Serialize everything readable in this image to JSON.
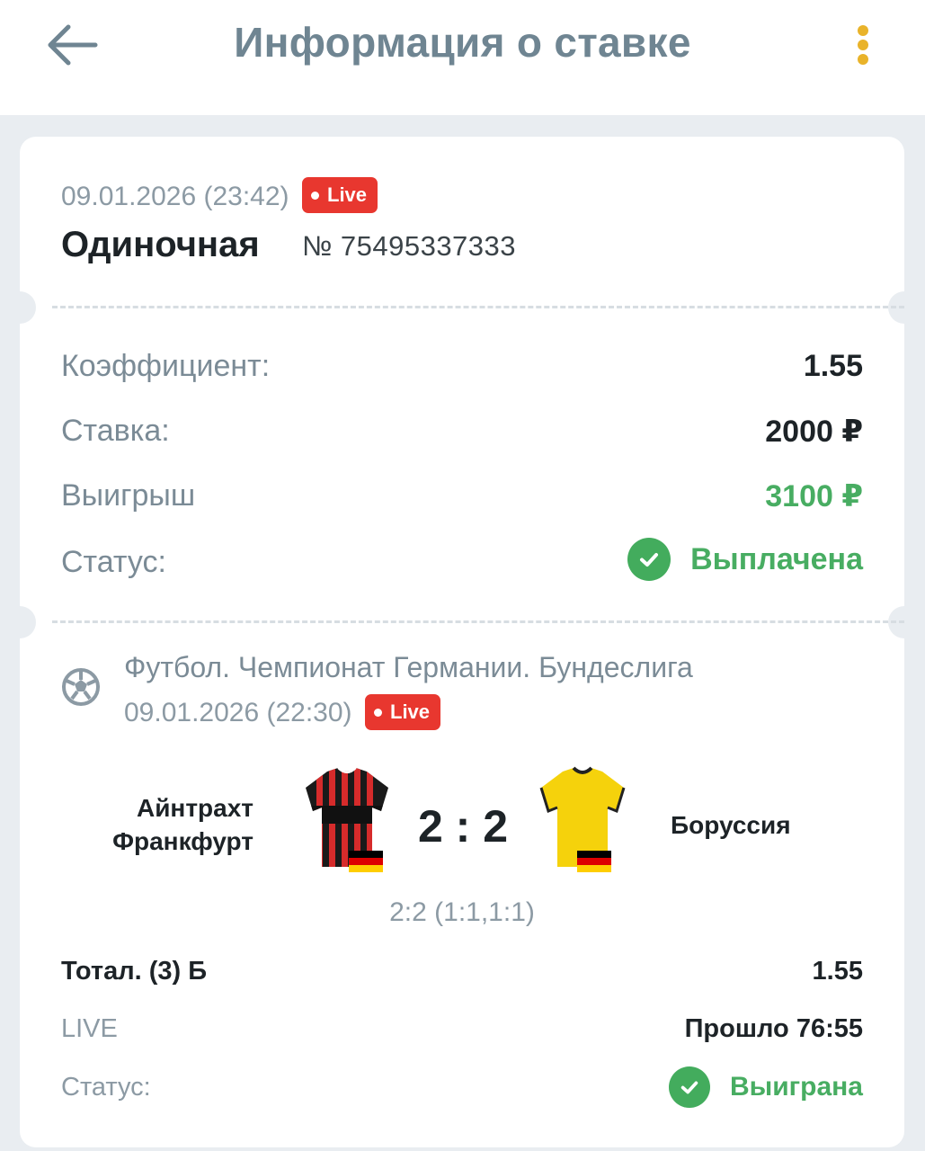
{
  "header": {
    "title": "Информация о ставке",
    "back_icon": "arrow-left-icon",
    "menu_icon": "more-vertical-icon",
    "accent_color": "#e9b32a"
  },
  "bet": {
    "date": "09.01.2026 (23:42)",
    "live_badge": "Live",
    "type": "Одиночная",
    "number": "№ 75495337333"
  },
  "summary": {
    "coef_label": "Коэффициент:",
    "coef_value": "1.55",
    "stake_label": "Ставка:",
    "stake_value": "2000 ₽",
    "win_label": "Выигрыш",
    "win_value": "3100 ₽",
    "status_label": "Статус:",
    "status_value": "Выплачена",
    "status_icon": "check-circle-icon",
    "status_color": "#48ad62"
  },
  "event": {
    "sport_icon": "football-icon",
    "league": "Футбол. Чемпионат Германии. Бундеслига",
    "date": "09.01.2026 (22:30)",
    "live_badge": "Live",
    "home_team_line1": "Айнтрахт",
    "home_team_line2": "Франкфурт",
    "home_jersey_icon": "eintracht-jersey-icon",
    "away_team": "Боруссия",
    "away_jersey_icon": "borussia-jersey-icon",
    "flag_icon": "germany-flag-icon",
    "score": "2 : 2",
    "halves": "2:2 (1:1,1:1)"
  },
  "outcome": {
    "market": "Тотал. (3) Б",
    "coef": "1.55",
    "live_label": "LIVE",
    "elapsed": "Прошло 76:55",
    "status_label": "Статус:",
    "status_value": "Выиграна",
    "status_icon": "check-circle-icon"
  }
}
